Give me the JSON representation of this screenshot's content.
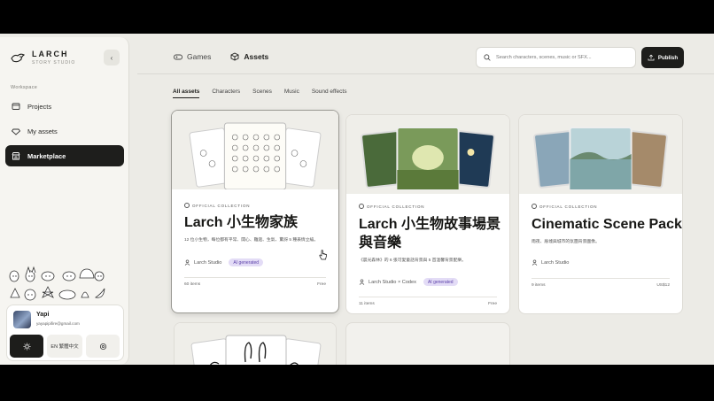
{
  "brand": {
    "name": "LARCH",
    "subtitle": "STORY STUDIO"
  },
  "sidebar": {
    "section_label": "Workspace",
    "items": [
      {
        "label": "Projects",
        "icon": "folder-icon",
        "active": false
      },
      {
        "label": "My assets",
        "icon": "diamond-icon",
        "active": false
      },
      {
        "label": "Marketplace",
        "icon": "store-icon",
        "active": true
      }
    ]
  },
  "user": {
    "name": "Yapi",
    "email": "yayapipifire@gmail.com",
    "language": "EN  繁體中文"
  },
  "top_tabs": [
    {
      "label": "Games",
      "icon": "gamepad-icon",
      "active": false
    },
    {
      "label": "Assets",
      "icon": "box-icon",
      "active": true
    }
  ],
  "search": {
    "placeholder": "Search characters, scenes, music or SFX..."
  },
  "publish_label": "Publish",
  "filters": [
    "All assets",
    "Characters",
    "Scenes",
    "Music",
    "Sound effects"
  ],
  "cards": [
    {
      "badge": "OFFICIAL COLLECTION",
      "title": "Larch 小生物家族",
      "description": "12 位小生物，每位都有平常、開心、難過、生氣、驚訝 5 種表情立繪。",
      "author": "Larch Studio",
      "tag": "AI generated",
      "items": "60 items",
      "price": "Free"
    },
    {
      "badge": "OFFICIAL COLLECTION",
      "title_line1": "Larch 小生物故事場景",
      "title_line2": "與音樂",
      "description": "《晨光森林》的 6 張可愛童話背景與 5 首溫馨背景配樂。",
      "author": "Larch Studio × Codex",
      "tag": "AI generated",
      "items": "11 items",
      "price": "Free"
    },
    {
      "badge": "OFFICIAL COLLECTION",
      "title": "Cinematic Scene Pack",
      "description": "雨夜、廢墟與城市的氛圍背景圖像。",
      "author": "Larch Studio",
      "items": "9 items",
      "price": "US$12"
    }
  ],
  "colors": {
    "accent_dark": "#1d1d1b",
    "ai_tag_bg": "#e3dcf6",
    "ai_tag_text": "#5a3fa8",
    "page_bg": "#ecebe6"
  }
}
